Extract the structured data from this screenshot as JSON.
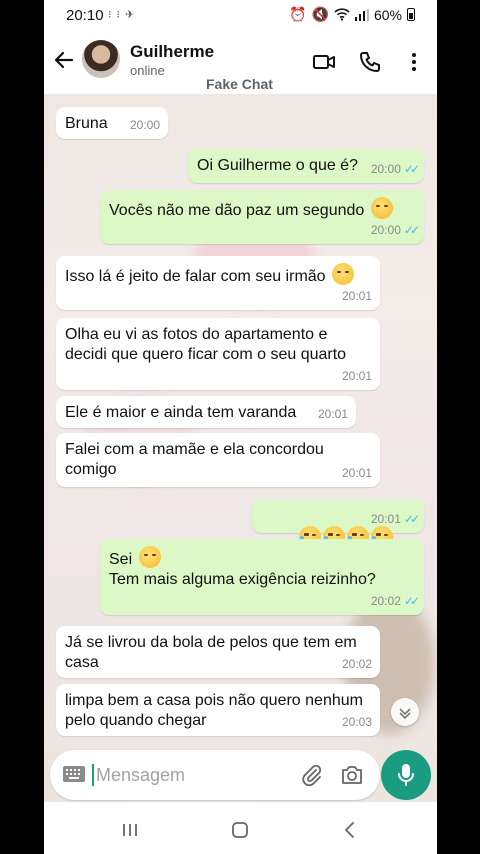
{
  "status_bar": {
    "time": "20:10",
    "left_icons": "⁝ ⁝ ✈",
    "battery": "60%"
  },
  "header": {
    "contact_name": "Guilherme",
    "contact_status": "online",
    "label": "Fake Chat"
  },
  "messages": [
    {
      "dir": "in",
      "text": "Bruna",
      "time": "20:00"
    },
    {
      "dir": "out",
      "text": "Oi Guilherme o que é?",
      "time": "20:00"
    },
    {
      "dir": "out",
      "text": "Vocês não me dão paz um segundo",
      "emoji": "roll",
      "time": "20:00"
    },
    {
      "dir": "in",
      "text": "Isso lá é jeito de falar com seu irmão",
      "emoji": "smirk",
      "time": "20:01"
    },
    {
      "dir": "in",
      "text": "Olha eu vi as fotos do apartamento e decidi que quero ficar com o seu quarto",
      "time": "20:01"
    },
    {
      "dir": "in",
      "text": "Ele é maior e ainda tem varanda",
      "time": "20:01"
    },
    {
      "dir": "in",
      "text": "Falei com a mamãe e ela concordou comigo",
      "time": "20:01"
    },
    {
      "dir": "out",
      "text": "",
      "emoji": "laugh4",
      "time": "20:01"
    },
    {
      "dir": "out",
      "text": "Sei\nTem mais alguma exigência reizinho?",
      "emoji": "smirk-first-line",
      "time": "20:02"
    },
    {
      "dir": "in",
      "text": "Já se livrou da bola de pelos que tem em casa",
      "time": "20:02"
    },
    {
      "dir": "in",
      "text": "limpa bem a casa pois não quero nenhum pelo quando chegar",
      "time": "20:03"
    }
  ],
  "input": {
    "placeholder": "Mensagem"
  },
  "colors": {
    "outgoing": "#dcf8c6",
    "incoming": "#ffffff",
    "accent": "#1a9c82",
    "read_ticks": "#4fb6ec"
  }
}
